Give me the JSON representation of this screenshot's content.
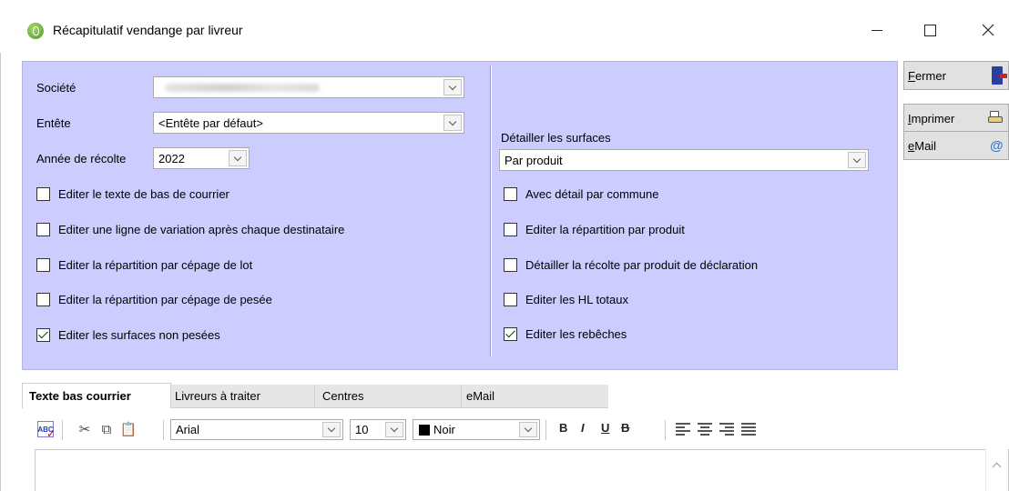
{
  "window": {
    "title": "Récapitulatif vendange par livreur",
    "app_icon": "grape-icon"
  },
  "form": {
    "societe": {
      "label": "Société",
      "value": ""
    },
    "entete": {
      "label": "Entête",
      "value": "<Entête par défaut>"
    },
    "annee": {
      "label": "Année de récolte",
      "value": "2022"
    },
    "detail_surfaces": {
      "label": "Détailler les surfaces",
      "value": "Par produit"
    }
  },
  "left_checkboxes": [
    {
      "label": "Editer le texte de bas de courrier",
      "checked": false
    },
    {
      "label": "Editer une ligne de variation après chaque destinataire",
      "checked": false
    },
    {
      "label": "Editer la répartition par cépage de lot",
      "checked": false
    },
    {
      "label": "Editer la répartition par cépage de pesée",
      "checked": false
    },
    {
      "label": "Editer les surfaces non pesées",
      "checked": true
    }
  ],
  "right_checkboxes": [
    {
      "label": "Avec détail par commune",
      "checked": false
    },
    {
      "label": "Editer la répartition par produit",
      "checked": false
    },
    {
      "label": "Détailler la récolte par produit de déclaration",
      "checked": false
    },
    {
      "label": "Editer les HL totaux",
      "checked": false
    },
    {
      "label": "Editer les rebêches",
      "checked": true
    }
  ],
  "buttons": {
    "fermer": {
      "accel": "F",
      "rest": "ermer",
      "icon": "exit-door-icon"
    },
    "imprimer": {
      "accel": "I",
      "rest": "mprimer",
      "icon": "printer-icon"
    },
    "email": {
      "accel": "e",
      "rest": "Mail",
      "icon": "at-sign-icon"
    }
  },
  "tabs": [
    "Texte bas courrier",
    "Livreurs à traiter",
    "Centres",
    "eMail"
  ],
  "active_tab": 0,
  "toolbar": {
    "font": "Arial",
    "size": "10",
    "color_label": "Noir",
    "color_hex": "#000000",
    "bold": "B",
    "italic": "I",
    "underline": "U",
    "strike": "B"
  }
}
